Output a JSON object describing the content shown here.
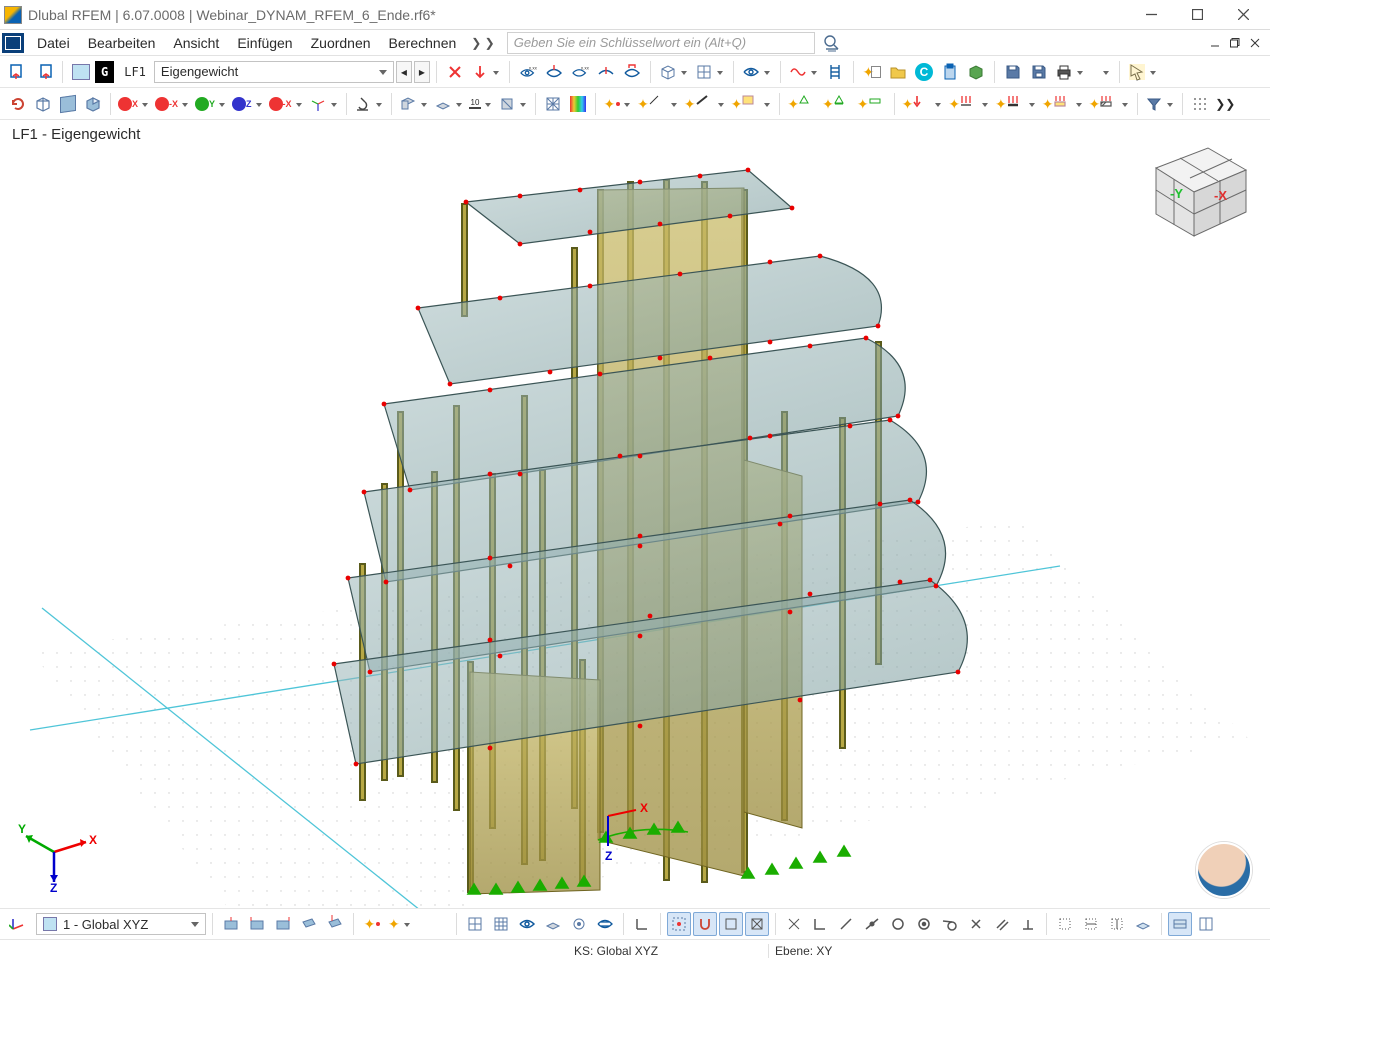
{
  "window": {
    "title": "Dlubal RFEM | 6.07.0008 | Webinar_DYNAM_RFEM_6_Ende.rf6*"
  },
  "menu": {
    "items": [
      "Datei",
      "Bearbeiten",
      "Ansicht",
      "Einfügen",
      "Zuordnen",
      "Berechnen"
    ],
    "overflow": "❯ ❯",
    "search_placeholder": "Geben Sie ein Schlüsselwort ein (Alt+Q)"
  },
  "loadcase": {
    "chip": "G",
    "id": "LF1",
    "name": "Eigengewicht",
    "viewport_label": "LF1 - Eigengewicht"
  },
  "cs": {
    "value": "1 - Global XYZ"
  },
  "status": {
    "ks": "KS: Global XYZ",
    "ebene": "Ebene: XY"
  },
  "orient": {
    "y": "-Y",
    "x": "-X"
  },
  "axis": {
    "x": "X",
    "y": "Y",
    "z": "Z"
  },
  "model_axis": {
    "x": "X",
    "z": "Z"
  }
}
